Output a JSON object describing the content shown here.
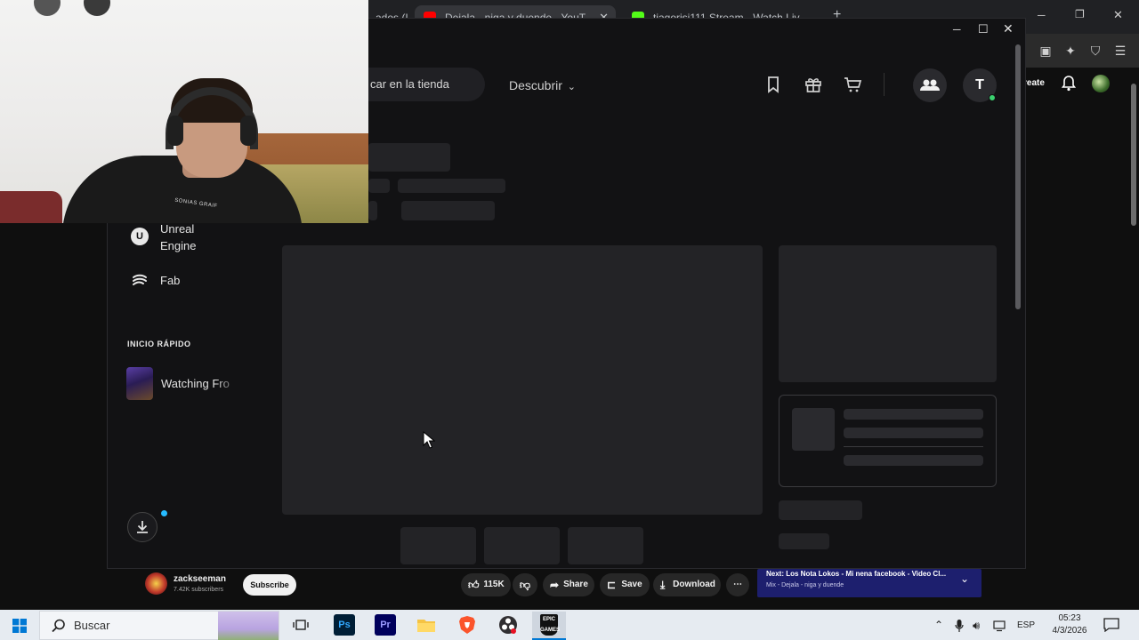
{
  "back_browser": {
    "tabs": [
      {
        "title": "...ados (I",
        "active": false
      },
      {
        "title": "Dejala - niga y duende - YouT",
        "active": true
      },
      {
        "title": "tiagorisi111 Stream - Watch Liv",
        "active": false
      }
    ],
    "new_tab": "+",
    "create_label": "reate"
  },
  "youtube": {
    "channel_name": "zackseeman",
    "subscribers": "7.42K subscribers",
    "subscribe_label": "Subscribe",
    "like_count": "115K",
    "share_label": "Share",
    "save_label": "Save",
    "download_label": "Download",
    "next_title": "Next: Los Nota Lokos - Mi nena facebook - Video Cl...",
    "next_sub": "Mix - Dejala - niga y duende"
  },
  "epic": {
    "search_placeholder": "car en la tienda",
    "discover_label": "Descubrir",
    "profile_initial": "T",
    "sidebar": {
      "items": [
        {
          "label": "Unreal Engine",
          "line1": "Unreal",
          "line2": "Engine",
          "icon": "unreal-icon"
        },
        {
          "label": "Fab",
          "icon": "fab-icon"
        }
      ],
      "quick_start_heading": "INICIO RÁPIDO",
      "quick_items": [
        {
          "label": "Watching Fro"
        }
      ]
    }
  },
  "webcam": {
    "shirt_text": "SONIAS GRAIF"
  },
  "taskbar": {
    "search_label": "Buscar",
    "language": "ESP",
    "time": "05:23",
    "date": "4/3/2026"
  },
  "colors": {
    "epic_bg": "#121214",
    "skeleton": "#232326",
    "yt_next_card": "#1d1f6e",
    "taskbar": "#e6ebf1",
    "online": "#3bd16f",
    "notif": "#26bbff"
  }
}
